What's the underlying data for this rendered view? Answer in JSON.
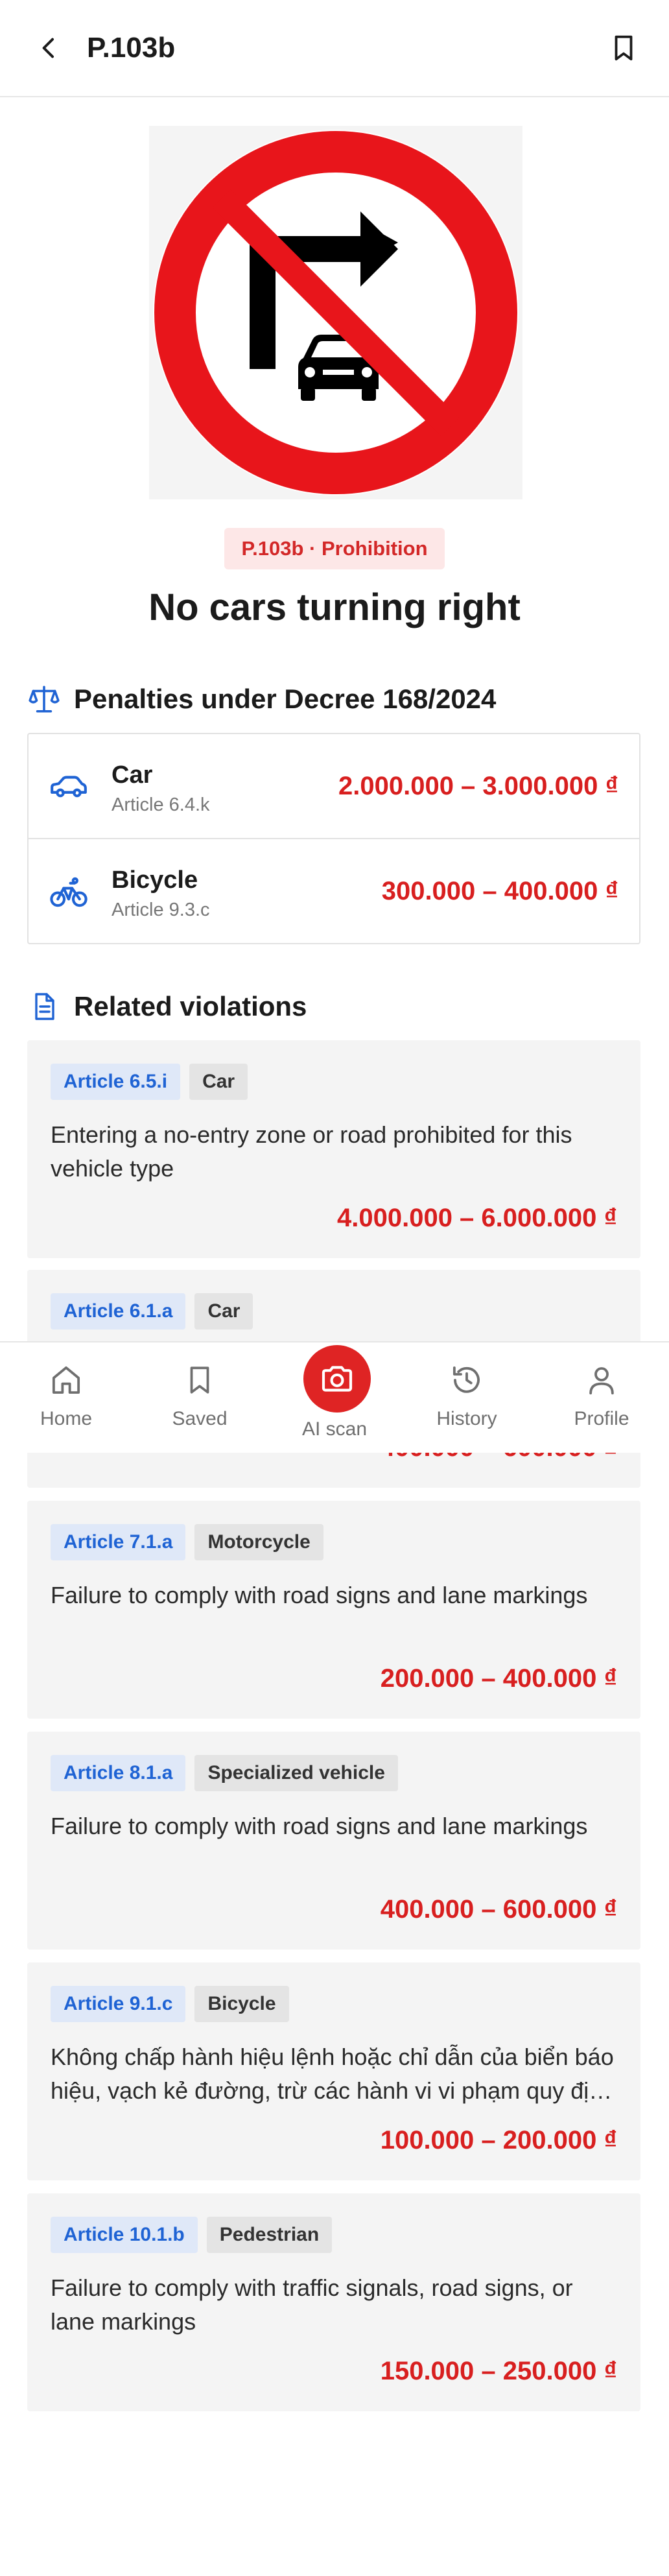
{
  "header": {
    "title": "P.103b"
  },
  "sign": {
    "badge": "P.103b · Prohibition",
    "name": "No cars turning right"
  },
  "penalties_section": {
    "title": "Penalties under Decree 168/2024",
    "rows": [
      {
        "vehicle": "Car",
        "article": "Article 6.4.k",
        "amount": "2.000.000 – 3.000.000 ₫",
        "icon": "car-icon"
      },
      {
        "vehicle": "Bicycle",
        "article": "Article 9.3.c",
        "amount": "300.000 – 400.000 ₫",
        "icon": "bicycle-icon"
      }
    ]
  },
  "related_section": {
    "title": "Related violations",
    "cards": [
      {
        "article": "Article 6.5.i",
        "vehicle": "Car",
        "description": "Entering a no-entry zone or road prohibited for this vehicle type",
        "amount": "4.000.000 – 6.000.000 ₫"
      },
      {
        "article": "Article 6.1.a",
        "vehicle": "Car",
        "description": "",
        "amount": "400.000 – 600.000 ₫"
      },
      {
        "article": "Article 7.1.a",
        "vehicle": "Motorcycle",
        "description": "Failure to comply with road signs and lane markings",
        "amount": "200.000 – 400.000 ₫"
      },
      {
        "article": "Article 8.1.a",
        "vehicle": "Specialized vehicle",
        "description": "Failure to comply with road signs and lane markings",
        "amount": "400.000 – 600.000 ₫"
      },
      {
        "article": "Article 9.1.c",
        "vehicle": "Bicycle",
        "description": "Không chấp hành hiệu lệnh hoặc chỉ dẫn của biển báo hiệu, vạch kẻ đường, trừ các hành vi vi phạm quy định tại điểm khác",
        "amount": "100.000 – 200.000 ₫"
      },
      {
        "article": "Article 10.1.b",
        "vehicle": "Pedestrian",
        "description": "Failure to comply with traffic signals, road signs, or lane markings",
        "amount": "150.000 – 250.000 ₫"
      }
    ]
  },
  "bottom_nav": {
    "items": [
      {
        "label": "Home",
        "icon": "home-icon"
      },
      {
        "label": "Saved",
        "icon": "bookmark-icon"
      },
      {
        "label": "AI scan",
        "icon": "camera-icon"
      },
      {
        "label": "History",
        "icon": "history-icon"
      },
      {
        "label": "Profile",
        "icon": "user-icon"
      }
    ]
  },
  "colors": {
    "accent_red": "#df2424",
    "amount_red": "#d81f1f",
    "article_blue": "#1f63d4",
    "badge_bg": "#fde7e7"
  }
}
